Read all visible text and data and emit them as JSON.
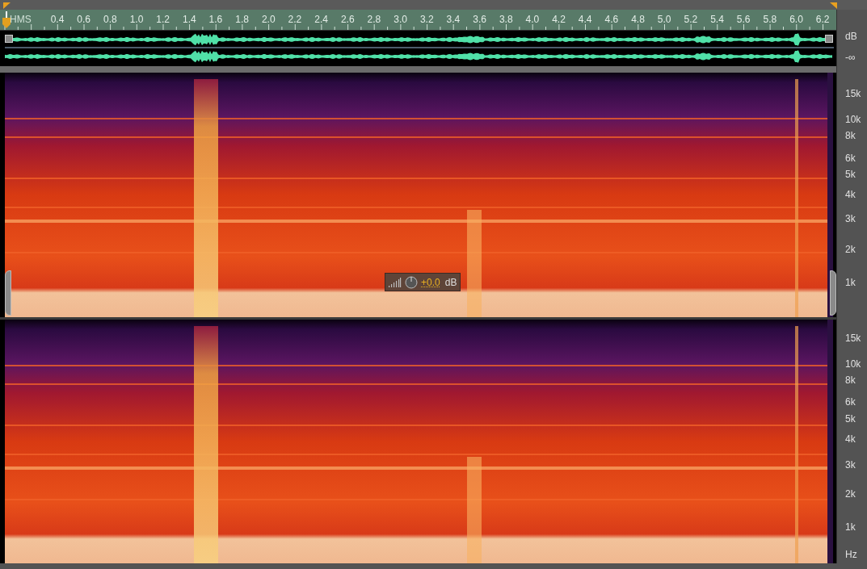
{
  "ruler": {
    "label": "HMS",
    "ticks": [
      "0.4",
      "0.6",
      "0.8",
      "1.0",
      "1.2",
      "1.4",
      "1.6",
      "1.8",
      "2.0",
      "2.2",
      "2.4",
      "2.6",
      "2.8",
      "3.0",
      "3.2",
      "3.4",
      "3.6",
      "3.8",
      "4.0",
      "4.2",
      "4.4",
      "4.6",
      "4.8",
      "5.0",
      "5.2",
      "5.4",
      "5.6",
      "5.8",
      "6.0",
      "6.2"
    ]
  },
  "waveform": {
    "scale": [
      "dB",
      "-∞"
    ]
  },
  "channels": [
    {
      "labels": [
        "15k",
        "10k",
        "8k",
        "6k",
        "5k",
        "4k",
        "3k",
        "2k",
        "1k"
      ]
    },
    {
      "labels": [
        "15k",
        "10k",
        "8k",
        "6k",
        "5k",
        "4k",
        "3k",
        "2k",
        "1k",
        "Hz"
      ]
    }
  ],
  "gain": {
    "value": "+0.0",
    "unit": "dB"
  }
}
